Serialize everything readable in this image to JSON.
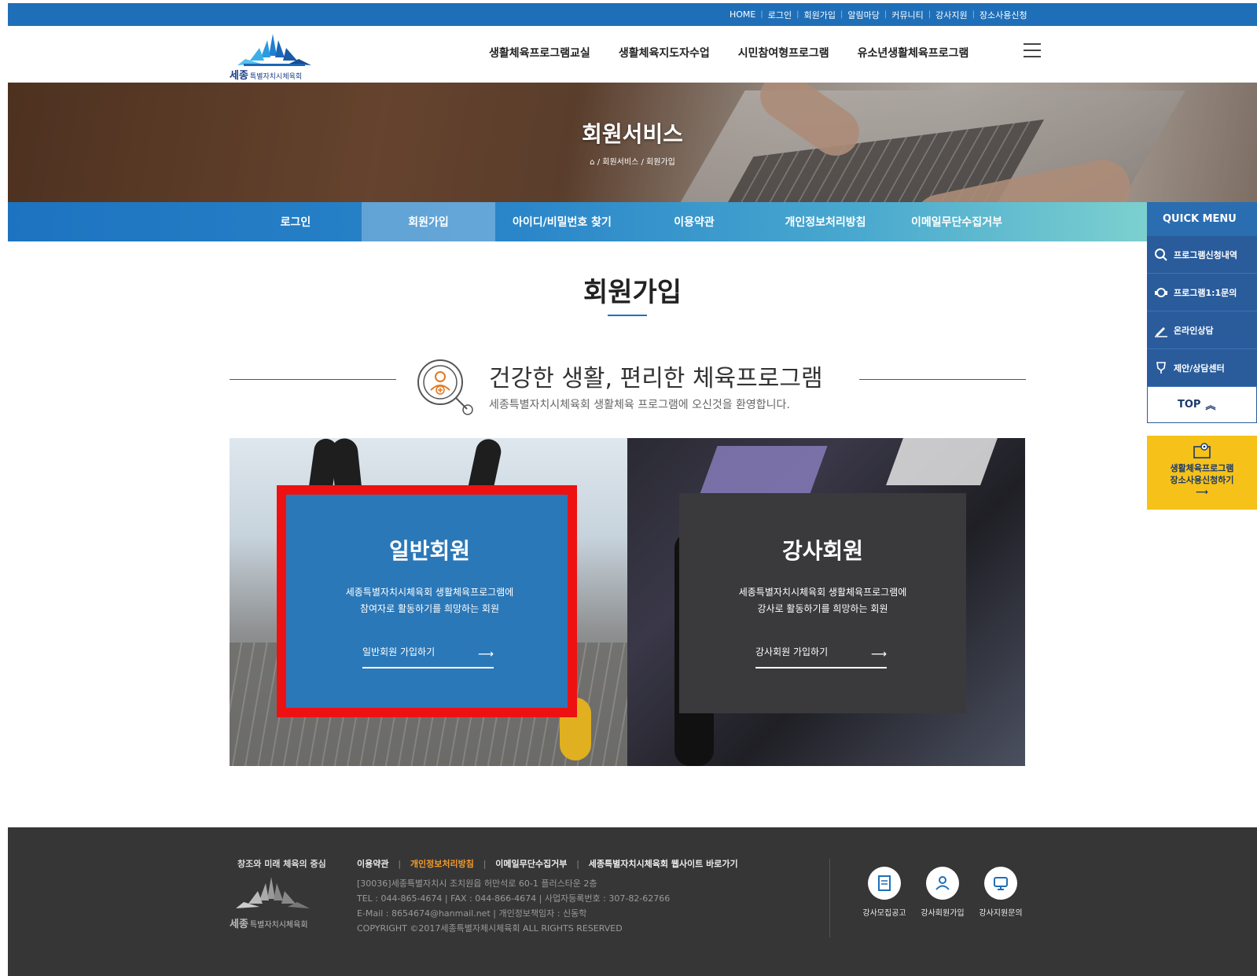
{
  "topbar": {
    "links": [
      "HOME",
      "로그인",
      "회원가입",
      "알림마당",
      "커뮤니티",
      "강사지원",
      "장소사용신청"
    ]
  },
  "header": {
    "logo_main": "세종",
    "logo_sub": "특별자치시체육회",
    "nav": [
      "생활체육프로그램교실",
      "생활체육지도자수업",
      "시민참여형프로그램",
      "유소년생활체육프로그램"
    ]
  },
  "hero": {
    "title": "회원서비스",
    "breadcrumb": [
      "회원서비스",
      "회원가입"
    ]
  },
  "subnav": {
    "tabs": [
      "로그인",
      "회원가입",
      "아이디/비밀번호 찾기",
      "이용약관",
      "개인정보처리방침",
      "이메일무단수집거부"
    ],
    "active_index": 1
  },
  "quick_menu": {
    "title": "QUICK MENU",
    "items": [
      "프로그램신청내역",
      "프로그램1:1문의",
      "온라인상담",
      "제안/상담센터"
    ],
    "top_label": "TOP",
    "banner_line1": "생활체육프로그램",
    "banner_line2": "장소사용신청하기"
  },
  "page": {
    "title": "회원가입",
    "intro_heading": "건강한 생활, 편리한 체육프로그램",
    "intro_text": "세종특별자치시체육회 생활체육 프로그램에 오신것을 환영합니다."
  },
  "cards": {
    "general": {
      "title": "일반회원",
      "desc1": "세종특별자치시체육회 생활체육프로그램에",
      "desc2": "참여자로 활동하기를 희망하는 회원",
      "link": "일반회원 가입하기"
    },
    "instructor": {
      "title": "강사회원",
      "desc1": "세종특별자치시체육회 생활체육프로그램에",
      "desc2": "강사로 활동하기를 희망하는 회원",
      "link": "강사회원 가입하기"
    }
  },
  "footer": {
    "slogan": "창조와 미래 체육의 중심",
    "logo_main": "세종",
    "logo_sub": "특별자치시체육회",
    "links": [
      "이용약관",
      "개인정보처리방침",
      "이메일무단수집거부",
      "세종특별자치시체육회 웹사이트 바로가기"
    ],
    "address": "[30036]세종특별자치시 조치원읍 허만석로 60-1 플러스타운 2층",
    "contact": "TEL : 044-865-4674   |   FAX : 044-866-4674   |   사업자등록번호 : 307-82-62766",
    "email": "E-Mail : 8654674@hanmail.net   |   개인정보책임자 : 신동학",
    "copyright": "COPYRIGHT ©2017세종특별자체시체육회 ALL RIGHTS RESERVED",
    "buttons": [
      "강사모집공고",
      "강사회원가입",
      "강사지원문의"
    ]
  },
  "colors": {
    "brand_blue": "#1f6fb8",
    "card_blue": "#2b78b8",
    "card_dark": "#3a3a3c",
    "highlight_red": "#ee1111",
    "banner_yellow": "#f6c119",
    "footer_bg": "#363636"
  }
}
